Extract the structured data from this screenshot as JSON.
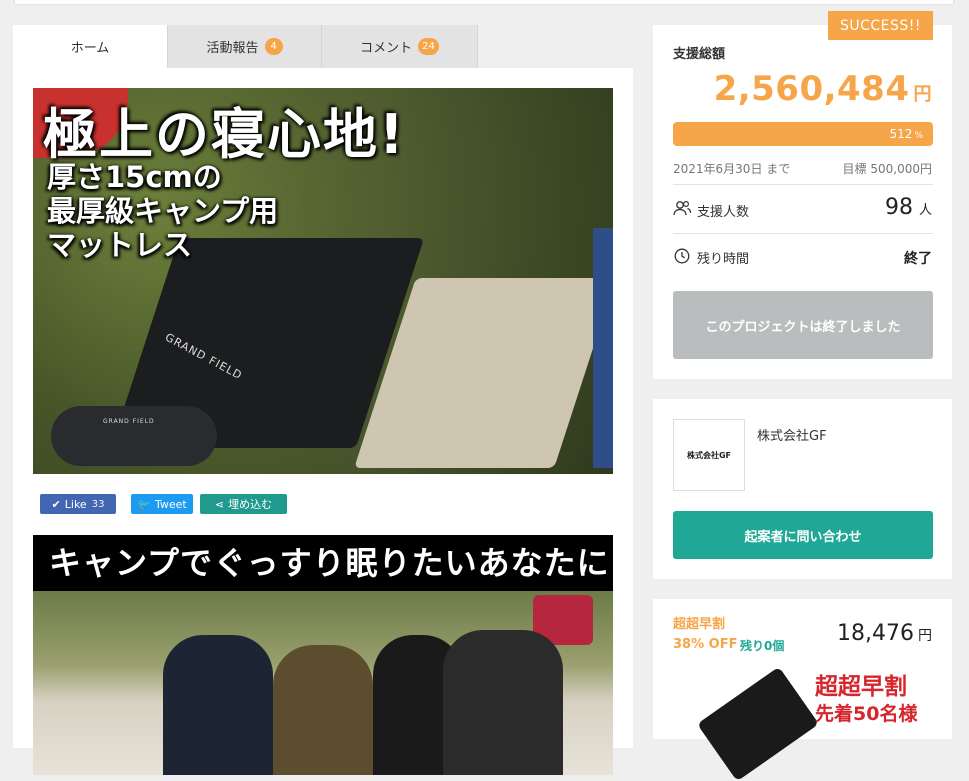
{
  "tabs": [
    {
      "label": "ホーム",
      "count": null
    },
    {
      "label": "活動報告",
      "count": "4"
    },
    {
      "label": "コメント",
      "count": "24"
    }
  ],
  "main_image": {
    "headline": "極上の寝心地!",
    "sub_line1": "厚さ15cmの",
    "sub_line2": "最厚級キャンプ用",
    "sub_line3": "マットレス",
    "brand": "GRAND FIELD",
    "bag_brand": "GRAND FIELD"
  },
  "share": {
    "like_label": "Like",
    "like_count": "33",
    "tweet_label": "Tweet",
    "embed_label": "埋め込む"
  },
  "second_image": {
    "banner": "キャンプでぐっすり眠りたいあなたに"
  },
  "summary": {
    "success_badge": "SUCCESS!!",
    "total_label": "支援総額",
    "total_amount": "2,560,484",
    "currency": "円",
    "progress_percent": 512,
    "progress_text": "512",
    "percent_sign": "%",
    "deadline": "2021年6月30日 まで",
    "goal": "目標 500,000円",
    "backers_label": "支援人数",
    "backers_count": "98",
    "backers_unit": "人",
    "time_label": "残り時間",
    "time_value": "終了",
    "ended_button": "このプロジェクトは終了しました"
  },
  "owner": {
    "logo_text": "株式会社GF",
    "name": "株式会社GF",
    "contact_button": "起案者に問い合わせ"
  },
  "reward": {
    "title": "超超早割",
    "discount": "38% OFF",
    "remaining": "残り0個",
    "price": "18,476",
    "currency": "円",
    "promo_line1": "超超早割",
    "promo_line2": "先着50名様"
  },
  "colors": {
    "accent": "#f6a548",
    "teal": "#1fa896",
    "facebook": "#4267b2",
    "twitter": "#1d9bf0",
    "disabled": "#b9bdbd"
  }
}
